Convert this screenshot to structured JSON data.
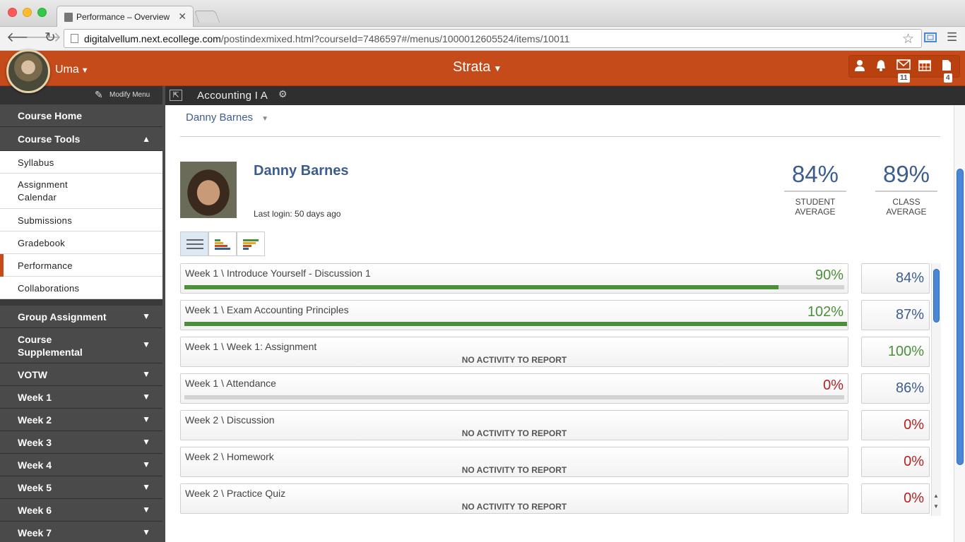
{
  "browser": {
    "tab_title": "Performance – Overview",
    "tab_close": "✕",
    "url_host": "digitalvellum.next.ecollege.com",
    "url_path": "/postindexmixed.html?courseId=7486597#/menus/1000012605524/items/10011"
  },
  "header": {
    "username": "Uma",
    "brand": "Strata",
    "messages_badge": "11",
    "documents_badge": "4"
  },
  "sidebar": {
    "modify_menu": "Modify Menu",
    "course_home": "Course Home",
    "course_tools": "Course Tools",
    "tools_items": [
      {
        "label": "Syllabus"
      },
      {
        "label": "Assignment\nCalendar"
      },
      {
        "label": "Submissions"
      },
      {
        "label": "Gradebook"
      },
      {
        "label": "Performance"
      },
      {
        "label": "Collaborations"
      }
    ],
    "sections": [
      {
        "label": "Group Assignment"
      },
      {
        "label": "Course\nSupplemental"
      },
      {
        "label": "VOTW"
      },
      {
        "label": "Week 1"
      },
      {
        "label": "Week 2"
      },
      {
        "label": "Week 3"
      },
      {
        "label": "Week 4"
      },
      {
        "label": "Week 5"
      },
      {
        "label": "Week 6"
      },
      {
        "label": "Week 7"
      }
    ]
  },
  "course": {
    "title": "Accounting I A"
  },
  "student": {
    "selector": "Danny Barnes",
    "name": "Danny Barnes",
    "last_login": "Last login: 50 days ago",
    "student_average": "84%",
    "student_average_label": "STUDENT\nAVERAGE",
    "class_average": "89%",
    "class_average_label": "CLASS\nAVERAGE"
  },
  "no_activity_text": "NO ACTIVITY TO REPORT",
  "rows": [
    {
      "name": "Week 1 \\ Introduce Yourself - Discussion 1",
      "score": "90%",
      "progress": 0.9,
      "class_avg": "84%"
    },
    {
      "name": "Week 1 \\ Exam Accounting Principles",
      "score": "102%",
      "progress": 1.0,
      "class_avg": "87%"
    },
    {
      "name": "Week 1 \\ Week 1: Assignment",
      "score": "",
      "class_avg": "100%"
    },
    {
      "name": "Week 1 \\ Attendance",
      "score": "0%",
      "progress": 0,
      "class_avg": "86%"
    },
    {
      "name": "Week 2 \\ Discussion",
      "score": "",
      "class_avg": "0%"
    },
    {
      "name": "Week 2 \\ Homework",
      "score": "",
      "class_avg": "0%"
    },
    {
      "name": "Week 2 \\ Practice Quiz",
      "score": "",
      "class_avg": "0%"
    }
  ],
  "colors": {
    "brand_orange": "#c54b1a",
    "score_green": "#4c8f3a",
    "score_red": "#b52222",
    "link_blue": "#3d5d8f"
  }
}
